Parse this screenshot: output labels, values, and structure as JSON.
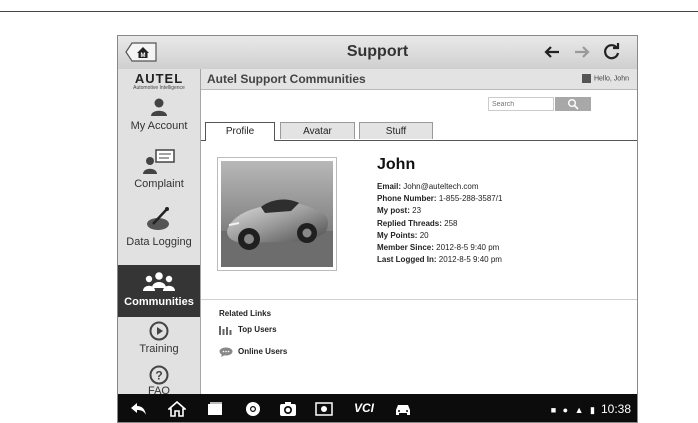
{
  "header": {
    "title": "Support",
    "home_icon": "home-icon",
    "back_icon": "arrow-left-icon",
    "forward_icon": "arrow-right-icon",
    "refresh_icon": "refresh-icon"
  },
  "brand": {
    "name": "AUTEL",
    "tagline": "Automotive Intelligence"
  },
  "sidebar": {
    "items": [
      {
        "label": "My Account",
        "icon": "user-icon"
      },
      {
        "label": "Complaint",
        "icon": "complaint-icon"
      },
      {
        "label": "Data Logging",
        "icon": "data-logging-icon"
      },
      {
        "label": "Communities",
        "icon": "communities-icon",
        "active": true
      },
      {
        "label": "Training",
        "icon": "play-icon"
      },
      {
        "label": "FAQ",
        "icon": "question-icon"
      }
    ]
  },
  "main": {
    "title": "Autel Support Communities",
    "greeting": "Hello, John",
    "search_placeholder": "Search",
    "tabs": [
      {
        "label": "Profile",
        "active": true
      },
      {
        "label": "Avatar"
      },
      {
        "label": "Stuff"
      }
    ],
    "profile": {
      "name": "John",
      "email_label": "Email",
      "email": "John@auteltech.com",
      "phone_label": "Phone Number",
      "phone": "1-855-288-3587/1",
      "posts_label": "My post",
      "posts": "23",
      "replied_label": "Replied Threads",
      "replied": "258",
      "points_label": "My Points",
      "points": "20",
      "member_since_label": "Member Since",
      "member_since": "2012-8-5 9:40 pm",
      "last_login_label": "Last Logged In",
      "last_login": "2012-8-5 9:40 pm"
    },
    "related": {
      "title": "Related Links",
      "links": [
        {
          "label": "Top Users",
          "icon": "bar-chart-icon"
        },
        {
          "label": "Online Users",
          "icon": "chat-icon"
        }
      ]
    }
  },
  "system_bar": {
    "vci_label": "VCI",
    "time": "10:38"
  },
  "colors": {
    "active_sidebar_bg": "#353535",
    "system_bar_bg": "#0c0c0c",
    "header_bg": "#e3e3e3"
  }
}
